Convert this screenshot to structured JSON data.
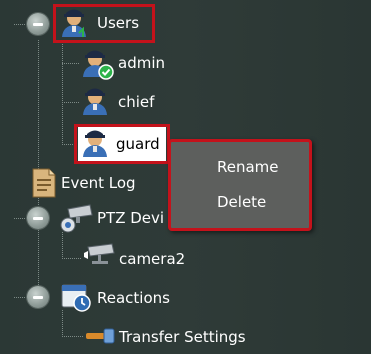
{
  "tree": {
    "users": {
      "label": "Users"
    },
    "admin": {
      "label": "admin"
    },
    "chief": {
      "label": "chief"
    },
    "guard": {
      "label": "guard"
    },
    "event_log": {
      "label": "Event Log"
    },
    "ptz": {
      "label": "PTZ Devi"
    },
    "camera2": {
      "label": "camera2"
    },
    "reactions": {
      "label": "Reactions"
    },
    "transfer_settings": {
      "label": "Transfer Settings"
    }
  },
  "context_menu": {
    "items": [
      {
        "label": "Rename"
      },
      {
        "label": "Delete"
      }
    ]
  },
  "icons": {
    "collapse": "minus-circle-icon",
    "user": "user-icon",
    "admin_badge": "check-badge-icon",
    "event_log": "document-icon",
    "ptz": "ptz-camera-icon",
    "camera": "camera-icon",
    "reactions": "calendar-clock-icon",
    "transfer": "transfer-icon"
  },
  "colors": {
    "highlight": "#c4121b",
    "background": "#2f3b38",
    "menu_background": "#5d5f5d",
    "check_badge": "#2db34a"
  }
}
